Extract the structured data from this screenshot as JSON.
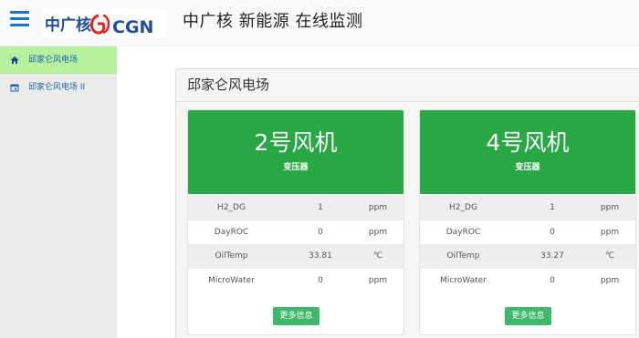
{
  "header": {
    "logo_text": "中广核CGN",
    "title": "中广核 新能源 在线监测",
    "brand_color": "#1a73c9",
    "logo_red": "#e8231f",
    "logo_blue": "#1f4e9f"
  },
  "sidebar": {
    "items": [
      {
        "label": "邱家仑风电场",
        "icon": "home-icon",
        "active": true
      },
      {
        "label": "邱家仑风电场 II",
        "icon": "calendar-icon",
        "active": false
      }
    ],
    "active_bg": "#b6f09e"
  },
  "panel": {
    "title": "邱家仑风电场"
  },
  "cards": [
    {
      "title": "2号风机",
      "subtitle": "变压器",
      "rows": [
        {
          "name": "H2_DG",
          "value": "1",
          "unit": "ppm"
        },
        {
          "name": "DayROC",
          "value": "0",
          "unit": "ppm"
        },
        {
          "name": "OilTemp",
          "value": "33.81",
          "unit": "℃"
        },
        {
          "name": "MicroWater",
          "value": "0",
          "unit": "ppm"
        }
      ],
      "button": "更多信息"
    },
    {
      "title": "4号风机",
      "subtitle": "变压器",
      "rows": [
        {
          "name": "H2_DG",
          "value": "1",
          "unit": "ppm"
        },
        {
          "name": "DayROC",
          "value": "0",
          "unit": "ppm"
        },
        {
          "name": "OilTemp",
          "value": "33.27",
          "unit": "℃"
        },
        {
          "name": "MicroWater",
          "value": "0",
          "unit": "ppm"
        }
      ],
      "button": "更多信息"
    }
  ],
  "colors": {
    "card_header": "#28a745",
    "button": "#3eb96b"
  }
}
